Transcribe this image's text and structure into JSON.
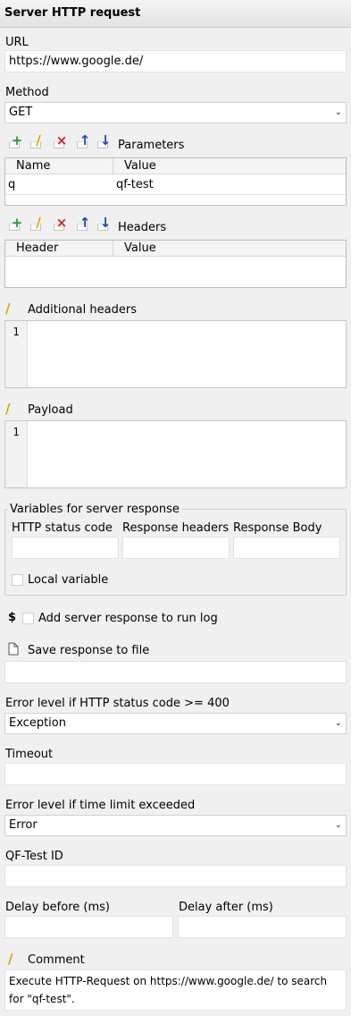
{
  "header": {
    "title": "Server HTTP request"
  },
  "url": {
    "label": "URL",
    "value": "https://www.google.de/"
  },
  "method": {
    "label": "Method",
    "value": "GET"
  },
  "parameters": {
    "label": "Parameters",
    "columns": [
      "Name",
      "Value"
    ],
    "rows": [
      {
        "name": "q",
        "value": "qf-test"
      }
    ]
  },
  "headers": {
    "label": "Headers",
    "columns": [
      "Header",
      "Value"
    ]
  },
  "additional_headers": {
    "label": "Additional headers",
    "line_number": "1"
  },
  "payload": {
    "label": "Payload",
    "line_number": "1"
  },
  "variables": {
    "legend": "Variables for server response",
    "status_label": "HTTP status code",
    "headers_label": "Response headers",
    "body_label": "Response Body",
    "local_label": "Local variable"
  },
  "run_log": {
    "symbol": "$",
    "label": "Add server response to run log"
  },
  "save_file": {
    "label": "Save response to file"
  },
  "error_status": {
    "label": "Error level if HTTP status code >= 400",
    "value": "Exception"
  },
  "timeout": {
    "label": "Timeout"
  },
  "error_time": {
    "label": "Error level if time limit exceeded",
    "value": "Error"
  },
  "qftest_id": {
    "label": "QF-Test ID"
  },
  "delay": {
    "before_label": "Delay before (ms)",
    "after_label": "Delay after (ms)"
  },
  "comment": {
    "label": "Comment",
    "line1": "Execute HTTP-Request on https://www.google.de/ to search",
    "line2": "for \"qf-test\"."
  },
  "toolbar": {
    "add": "+",
    "edit": "/",
    "delete": "×",
    "up": "↑",
    "down": "↓"
  },
  "colors": {
    "add": "#2e9a2e",
    "edit": "#d9a500",
    "delete": "#d42020",
    "arrow": "#1f45b8"
  }
}
